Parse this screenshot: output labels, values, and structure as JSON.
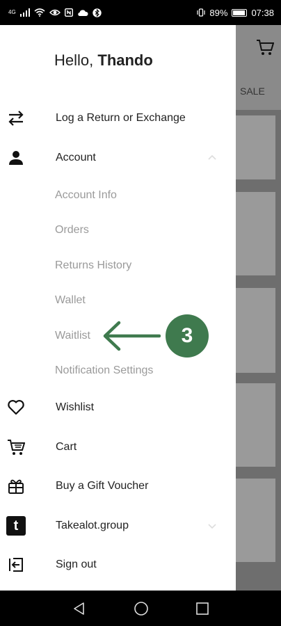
{
  "status_bar": {
    "left_icons": [
      "signal-icon",
      "wifi-icon",
      "eye-icon",
      "nfc-icon",
      "cloud-icon",
      "bluetooth-icon"
    ],
    "network": "4G",
    "battery": "89%",
    "time": "07:38"
  },
  "background": {
    "sale_label": "SALE"
  },
  "drawer": {
    "greeting_prefix": "Hello,",
    "user_name": "Thando",
    "items": [
      {
        "label": "Log a Return or Exchange",
        "icon": "swap-arrows-icon"
      },
      {
        "label": "Account",
        "icon": "person-icon",
        "expanded": true
      },
      {
        "label": "Wishlist",
        "icon": "heart-icon"
      },
      {
        "label": "Cart",
        "icon": "cart-icon"
      },
      {
        "label": "Buy a Gift Voucher",
        "icon": "gift-icon"
      },
      {
        "label": "Takealot.group",
        "icon": "takealot-logo-icon",
        "expanded": false
      },
      {
        "label": "Sign out",
        "icon": "sign-out-icon"
      }
    ],
    "account_subitems": [
      "Account Info",
      "Orders",
      "Returns History",
      "Wallet",
      "Waitlist",
      "Notification Settings"
    ],
    "logo_letter": "t"
  },
  "annotation": {
    "step_number": "3",
    "color": "#3f7a4e"
  },
  "nav_bar": {
    "buttons": [
      "back-icon",
      "home-icon",
      "recents-icon"
    ]
  }
}
